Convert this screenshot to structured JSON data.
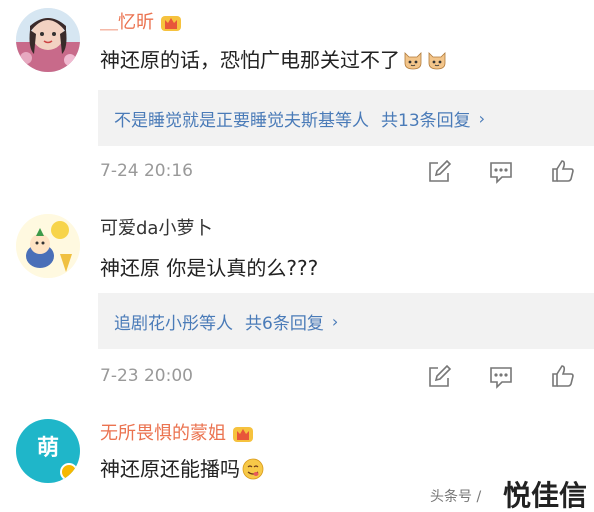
{
  "comments": [
    {
      "username": "＿忆昕",
      "text": "神还原的话，恐怕广电那关过不了",
      "replies": {
        "summary": "不是睡觉就是正要睡觉夫斯基等人",
        "count": "共13条回复"
      },
      "timestamp": "7-24 20:16",
      "username_color": "#eb7350"
    },
    {
      "username": "可爱da小萝卜",
      "text": "神还原  你是认真的么???",
      "replies": {
        "summary": "追剧花小彤等人",
        "count": "共6条回复"
      },
      "timestamp": "7-23 20:00",
      "username_color": "#333333"
    },
    {
      "username": "无所畏惧的蒙姐",
      "text": "神还原还能播吗",
      "avatar_text": "萌",
      "username_color": "#eb7350"
    }
  ],
  "watermark": {
    "source": "头条号 / ",
    "name": "悦佳信"
  },
  "icons": {
    "edit": "edit-icon",
    "comment": "comment-icon",
    "like": "like-icon",
    "crown": "crown-badge-icon"
  },
  "colors": {
    "link_blue": "#4a7bb8",
    "meta_gray": "#999999",
    "vip_orange": "#eb7350"
  }
}
